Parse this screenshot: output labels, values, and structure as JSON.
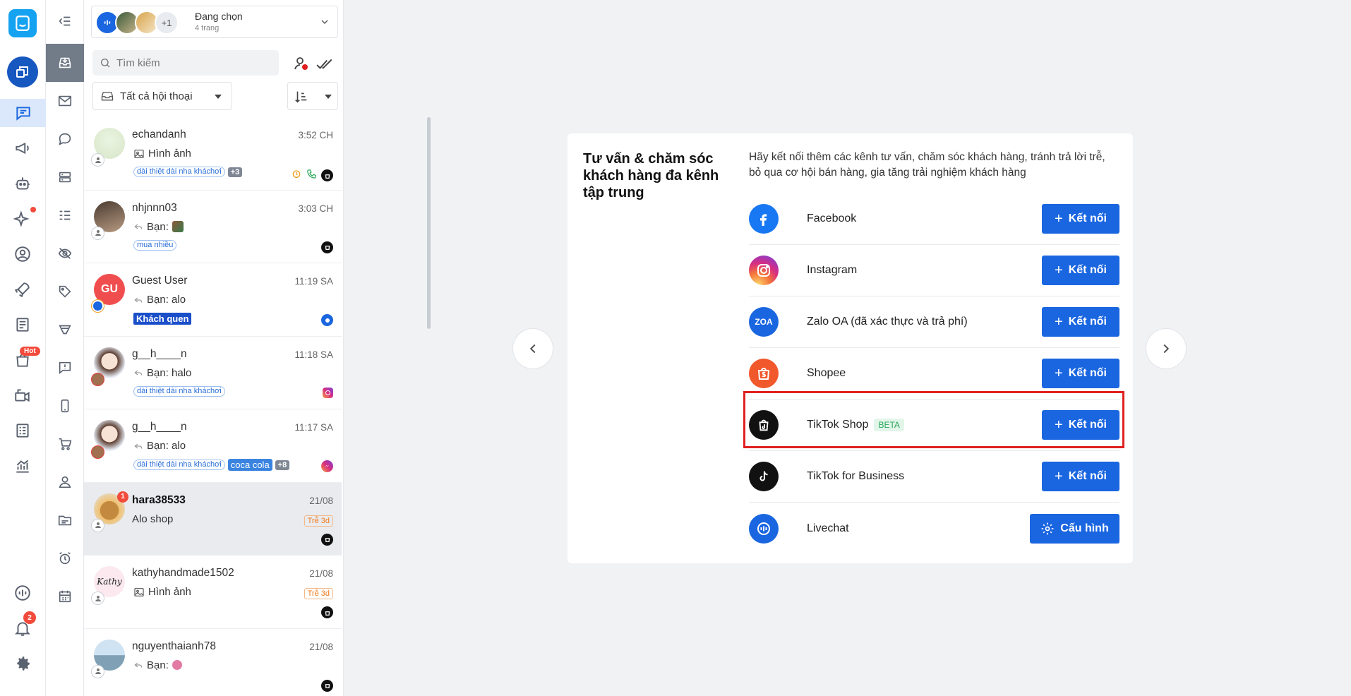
{
  "page_selector": {
    "title": "Đang chọn",
    "subtitle": "4 trang",
    "more_count": "+1"
  },
  "search": {
    "placeholder": "Tìm kiếm"
  },
  "filter": {
    "label": "Tất cả hội thoại"
  },
  "rail": {
    "hot_badge": "Hot",
    "notification_count": "2"
  },
  "conversations": [
    {
      "name": "echandanh",
      "time": "3:52 CH",
      "message": "Hình ảnh",
      "tags": [
        "dài thiệt dài nha kháchơi"
      ],
      "more_tags": "+3"
    },
    {
      "name": "nhjnnn03",
      "time": "3:03 CH",
      "message": "Bạn:",
      "tags": [
        "mua nhiều"
      ]
    },
    {
      "name": "Guest User",
      "time": "11:19 SA",
      "message": "Bạn: alo",
      "solid_tag": "Khách quen",
      "initials": "GU"
    },
    {
      "name": "g__h____n",
      "time": "11:18 SA",
      "message": "Bạn: halo",
      "tags": [
        "dài thiệt dài nha kháchơi"
      ]
    },
    {
      "name": "g__h____n",
      "time": "11:17 SA",
      "message": "Bạn: alo",
      "tags": [
        "dài thiệt dài nha kháchơi"
      ],
      "cola_tag": "coca cola",
      "more_tags": "+8"
    },
    {
      "name": "hara38533",
      "time": "21/08",
      "message": "Alo shop",
      "late": "Trễ 3d",
      "unread": "1"
    },
    {
      "name": "kathyhandmade1502",
      "time": "21/08",
      "message": "Hình ảnh",
      "late": "Trễ 3d"
    },
    {
      "name": "nguyenthaianh78",
      "time": "21/08",
      "message": "Bạn:"
    }
  ],
  "card": {
    "title": "Tư vấn & chăm sóc khách hàng đa kênh tập trung",
    "description": "Hãy kết nối thêm các kênh tư vấn, chăm sóc khách hàng, tránh trả lời trễ, bỏ qua cơ hội bán hàng, gia tăng trải nghiệm khách hàng",
    "channels": [
      {
        "name": "Facebook",
        "button": "Kết nối"
      },
      {
        "name": "Instagram",
        "button": "Kết nối"
      },
      {
        "name": "Zalo OA (đã xác thực và trả phí)",
        "button": "Kết nối",
        "icon_text": "ZOA"
      },
      {
        "name": "Shopee",
        "button": "Kết nối"
      },
      {
        "name": "TikTok Shop",
        "badge": "BETA",
        "button": "Kết nối"
      },
      {
        "name": "TikTok for Business",
        "button": "Kết nối"
      },
      {
        "name": "Livechat",
        "button": "Cấu hình"
      }
    ]
  },
  "colors": {
    "primary": "#1a66e0",
    "highlight": "#e02020",
    "accent_red": "#f24b3c"
  }
}
